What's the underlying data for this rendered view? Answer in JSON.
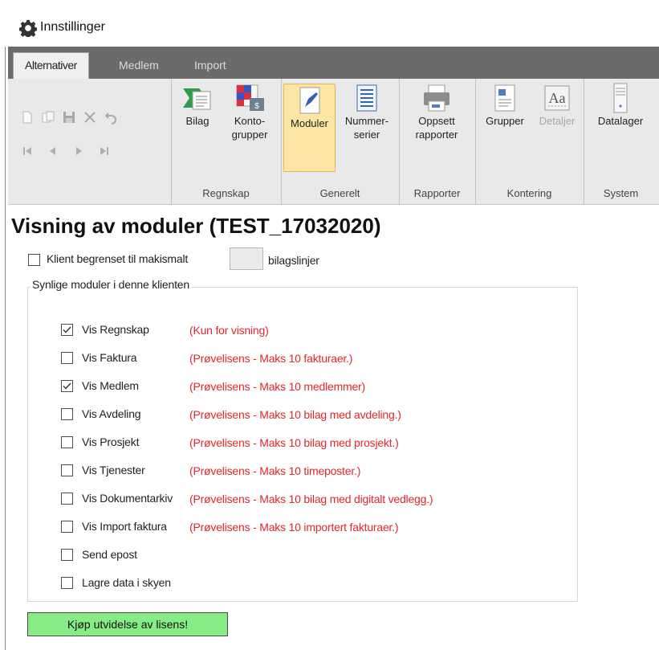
{
  "window": {
    "title": "Innstillinger",
    "icon": "gear-icon"
  },
  "tabs": [
    {
      "label": "Alternativer",
      "active": true
    },
    {
      "label": "Medlem",
      "active": false
    },
    {
      "label": "Import",
      "active": false
    }
  ],
  "ribbon": {
    "quick_icons": [
      "new-icon",
      "copy-icon",
      "save-icon",
      "delete-icon",
      "undo-icon",
      "first-icon",
      "previous-icon",
      "next-icon",
      "last-icon"
    ],
    "groups": [
      {
        "label": "Regnskap",
        "buttons": [
          {
            "line1": "Bilag",
            "line2": ""
          },
          {
            "line1": "Konto-",
            "line2": "grupper"
          }
        ]
      },
      {
        "label": "Generelt",
        "buttons": [
          {
            "line1": "Moduler",
            "line2": "",
            "selected": true
          },
          {
            "line1": "Nummer-",
            "line2": "serier"
          }
        ]
      },
      {
        "label": "Rapporter",
        "buttons": [
          {
            "line1": "Oppsett",
            "line2": "rapporter"
          }
        ]
      },
      {
        "label": "Kontering",
        "buttons": [
          {
            "line1": "Grupper",
            "line2": ""
          },
          {
            "line1": "Detaljer",
            "line2": "",
            "disabled": true
          }
        ]
      },
      {
        "label": "System",
        "buttons": [
          {
            "line1": "Datalager",
            "line2": ""
          }
        ]
      }
    ]
  },
  "page": {
    "heading": "Visning av moduler (TEST_17032020)",
    "limit": {
      "label": "Klient begrenset til makismalt",
      "checked": false,
      "value": "",
      "suffix": "bilagslinjer"
    },
    "fieldset_label": "Synlige moduler i denne klienten",
    "modules": [
      {
        "label": "Vis Regnskap",
        "checked": true,
        "note": "(Kun for visning)"
      },
      {
        "label": "Vis Faktura",
        "checked": false,
        "note": "(Prøvelisens - Maks 10 fakturaer.)"
      },
      {
        "label": "Vis Medlem",
        "checked": true,
        "note": "(Prøvelisens - Maks 10 medlemmer)"
      },
      {
        "label": "Vis Avdeling",
        "checked": false,
        "note": "(Prøvelisens - Maks 10 bilag med avdeling.)"
      },
      {
        "label": "Vis Prosjekt",
        "checked": false,
        "note": "(Prøvelisens - Maks 10 bilag med prosjekt.)"
      },
      {
        "label": "Vis Tjenester",
        "checked": false,
        "note": "(Prøvelisens - Maks 10 timeposter.)"
      },
      {
        "label": "Vis Dokumentarkiv",
        "checked": false,
        "note": "(Prøvelisens - Maks 10 bilag med digitalt vedlegg.)"
      },
      {
        "label": "Vis Import faktura",
        "checked": false,
        "note": "(Prøvelisens - Maks 10 importert fakturaer.)"
      },
      {
        "label": "Send epost",
        "checked": false,
        "note": ""
      },
      {
        "label": "Lagre data i skyen",
        "checked": false,
        "note": ""
      }
    ],
    "buy_button": "Kjøp utvidelse av lisens!"
  },
  "colors": {
    "note_red": "#e2262b",
    "buy_green": "#86ec86",
    "selected_bg": "#fbe6a3",
    "tabstrip": "#6b6b6b",
    "ribbon_bg": "#e9e9e9"
  }
}
